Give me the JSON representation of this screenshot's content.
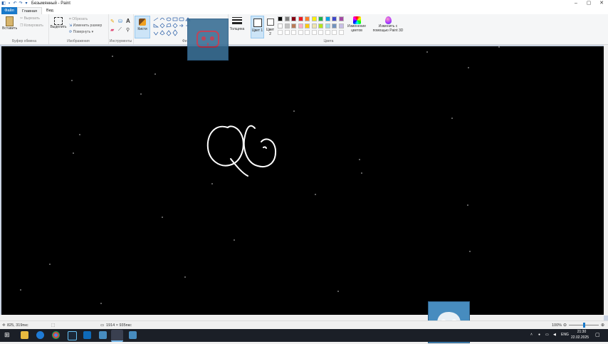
{
  "window": {
    "title": "Безымянный - Paint",
    "minimize": "–",
    "maximize": "▢",
    "close": "✕"
  },
  "tabs": {
    "file": "Файл",
    "home": "Главная",
    "view": "Вид"
  },
  "clipboard": {
    "paste": "Вставить",
    "cut": "Вырезать",
    "copy": "Копировать",
    "group": "Буфер обмена"
  },
  "image": {
    "select": "Выделить",
    "crop": "Обрезать",
    "resize": "Изменить размер",
    "rotate": "Повернуть ▾",
    "group": "Изображения"
  },
  "tools": {
    "group": "Инструменты",
    "brushes": "Кисти"
  },
  "shapes": {
    "group": "Фи..",
    "thickness": "Толщина"
  },
  "colors": {
    "color1": "Цвет 1",
    "color2": "Цвет 2",
    "edit": "Изменение цветов",
    "paint3d": "Изменить с помощью Paint 3D",
    "group": "Цвета",
    "palette_row1": [
      "#000000",
      "#7f7f7f",
      "#880015",
      "#ed1c24",
      "#ff7f27",
      "#fff200",
      "#22b14c",
      "#00a2e8",
      "#3f48cc",
      "#a349a4"
    ],
    "palette_row2": [
      "#ffffff",
      "#c3c3c3",
      "#b97a57",
      "#ffaec9",
      "#ffc90e",
      "#efe4b0",
      "#b5e61d",
      "#99d9ea",
      "#7092be",
      "#c8bfe7"
    ]
  },
  "status": {
    "cursor": "825, 319пкс",
    "size": "1914 × 935пкс",
    "zoom": "100%"
  },
  "taskbar": {
    "lang": "ENG",
    "time": "21:30",
    "date": "22.02.2025"
  },
  "icons": [
    "save-icon",
    "undo-icon",
    "redo-icon",
    "paste-icon",
    "cut-icon",
    "copy-icon",
    "select-icon",
    "crop-icon",
    "resize-icon",
    "rotate-icon",
    "pencil-icon",
    "fill-icon",
    "text-icon",
    "eraser-icon",
    "picker-icon",
    "magnifier-icon",
    "brush-icon",
    "godot-icon",
    "windows-start-icon",
    "search-icon"
  ]
}
